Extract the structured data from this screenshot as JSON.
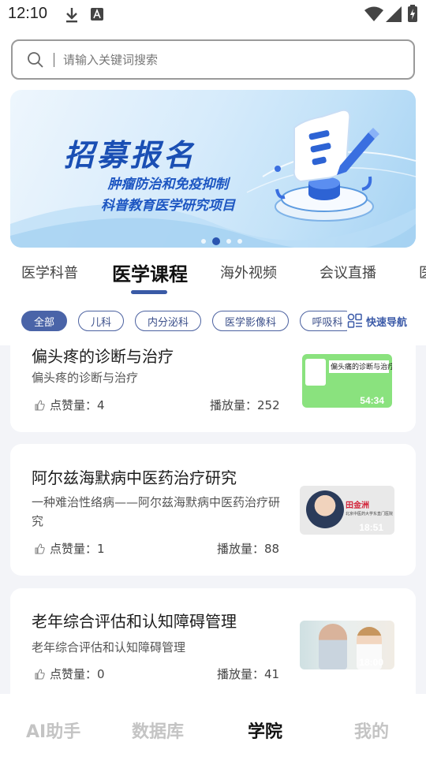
{
  "status": {
    "time": "12:10"
  },
  "search": {
    "placeholder": "请输入关键词搜索"
  },
  "banner": {
    "title": "招募报名",
    "line1": "肿瘤防治和免疫抑制",
    "line2": "科普教育医学研究项目"
  },
  "tabs": [
    "医学科普",
    "医学课程",
    "海外视频",
    "会议直播",
    "医"
  ],
  "chips": [
    "全部",
    "儿科",
    "内分泌科",
    "医学影像科",
    "呼吸科"
  ],
  "quick_nav": "快速导航",
  "courses": [
    {
      "title": "偏头疼的诊断与治疗",
      "desc": "偏头疼的诊断与治疗",
      "likes": "点赞量：4",
      "plays": "播放量：252",
      "thumb_title": "偏头痛的诊断与治疗",
      "duration": "54:34"
    },
    {
      "title": "阿尔兹海默病中医药治疗研究",
      "desc": "一种难治性络病——阿尔兹海默病中医药治疗研究",
      "likes": "点赞量：1",
      "plays": "播放量：88",
      "thumb_name": "田金洲",
      "thumb_org": "北京中医药大学东直门医院",
      "duration": "18:51"
    },
    {
      "title": "老年综合评估和认知障碍管理",
      "desc": "老年综合评估和认知障碍管理",
      "likes": "点赞量：0",
      "plays": "播放量：41",
      "duration": "18:00"
    }
  ],
  "nav": [
    "AI助手",
    "数据库",
    "学院",
    "我的"
  ],
  "colors": {
    "accent": "#3a5aa6",
    "banner_text": "#1a4fb4",
    "page_bg": "#f3f4f8"
  }
}
